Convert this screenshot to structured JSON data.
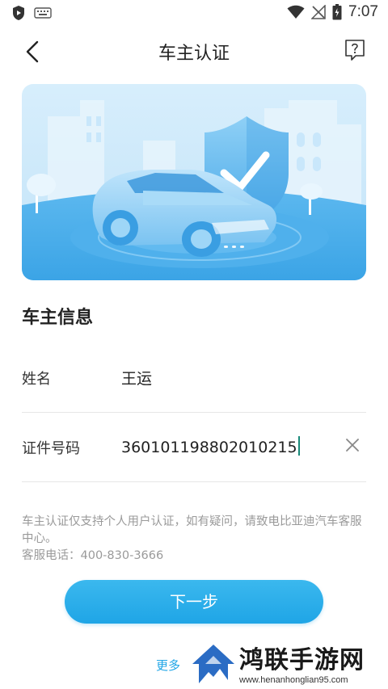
{
  "status_bar": {
    "time": "7:07"
  },
  "header": {
    "title": "车主认证"
  },
  "section": {
    "title": "车主信息"
  },
  "form": {
    "name_label": "姓名",
    "name_value": "王运",
    "id_label": "证件号码",
    "id_value": "360101198802010215"
  },
  "notice": {
    "line1": "车主认证仅支持个人用户认证，如有疑问，请致电比亚迪汽车客服中心。",
    "line2": "客服电话：400-830-3666"
  },
  "actions": {
    "next_label": "下一步",
    "more_label": "更多"
  },
  "watermark": {
    "text": "鸿联手游网",
    "url": "www.henanhonglian95.com"
  },
  "colors": {
    "accent": "#1fa5e6",
    "banner_bg": "#cfe9fb"
  }
}
